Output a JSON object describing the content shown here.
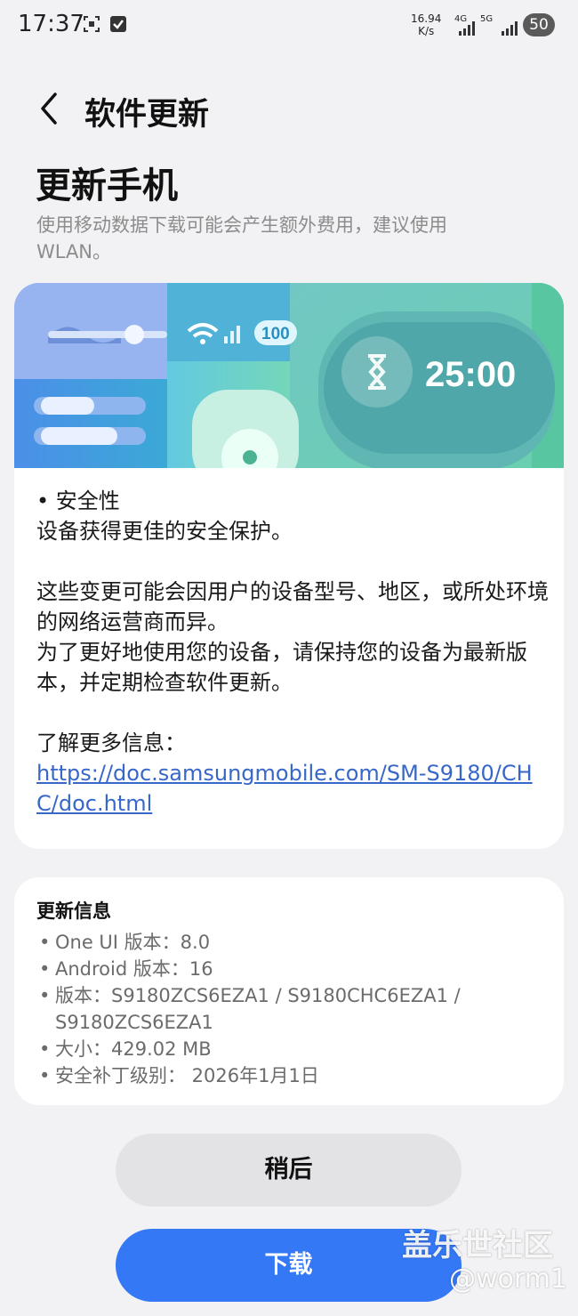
{
  "status_bar": {
    "time": "17:37",
    "speed_value": "16.94",
    "speed_unit": "K/s",
    "net1": "4G",
    "net2": "5G",
    "battery": "50"
  },
  "header": {
    "title": "软件更新",
    "back_icon": "chevron-left-icon"
  },
  "page": {
    "heading": "更新手机",
    "notice": "使用移动数据下载可能会产生额外费用，建议使用WLAN。"
  },
  "banner": {
    "timer": "25:00",
    "battery_badge": "100",
    "icons": [
      "wave-slider-icon",
      "wifi-icon",
      "signal-icon",
      "hourglass-icon",
      "flower-app-icon"
    ]
  },
  "details": {
    "bullet": "• 安全性",
    "bullet_desc": "设备获得更佳的安全保护。",
    "para1": "这些变更可能会因用户的设备型号、地区，或所处环境的网络运营商而异。",
    "para2": "为了更好地使用您的设备，请保持您的设备为最新版本，并定期检查软件更新。",
    "more_label": "了解更多信息：",
    "link": "https://doc.samsungmobile.com/SM-S9180/CHC/doc.html"
  },
  "update_info": {
    "title": "更新信息",
    "items": [
      "One UI 版本：8.0",
      "Android 版本：16",
      "版本：S9180ZCS6EZA1 / S9180CHC6EZA1 / S9180ZCS6EZA1",
      "大小：429.02 MB",
      "安全补丁级别： 2026年1月1日"
    ]
  },
  "buttons": {
    "later": "稍后",
    "download": "下载"
  },
  "watermark": {
    "line1": "盖乐世社区",
    "line2": "@worm1"
  },
  "colors": {
    "background": "#f2f2f4",
    "accent": "#3478f6",
    "link": "#3767c9"
  }
}
